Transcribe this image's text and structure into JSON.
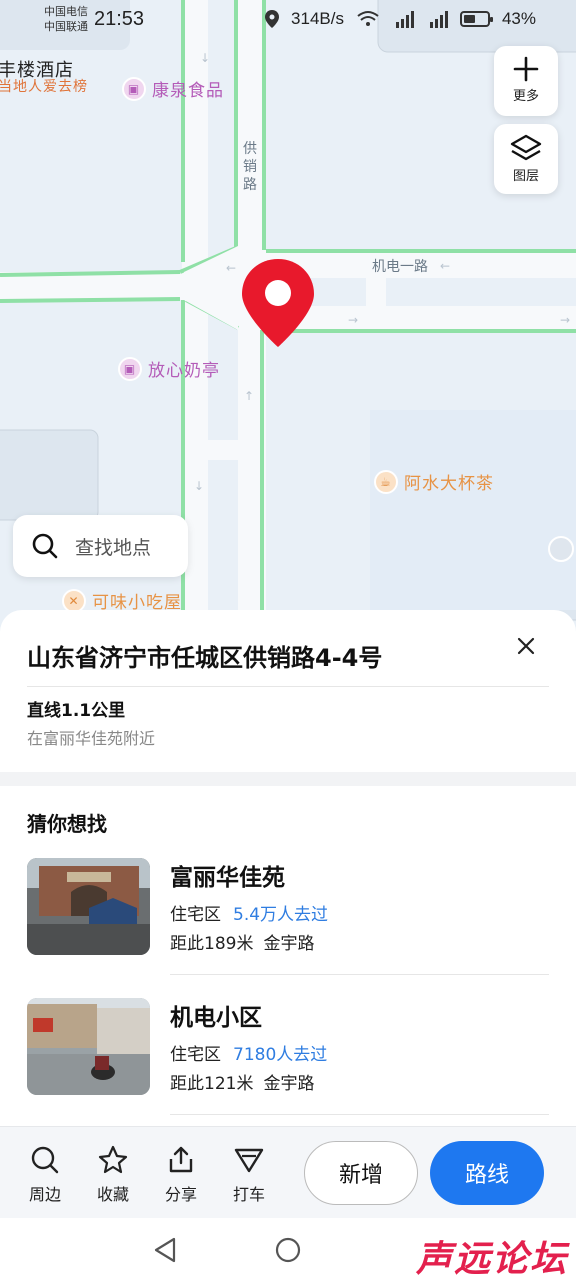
{
  "status_bar": {
    "carrier1": "中国电信",
    "carrier2": "中国联通",
    "time": "21:53",
    "speed": "314B/s",
    "battery": "43%"
  },
  "map": {
    "poi": {
      "hotel": "丰楼酒店",
      "hotel_tag": "当地人爱去榜",
      "kangquan": "康泉食品",
      "milk": "放心奶亭",
      "tea": "阿水大杯茶",
      "snack": "可味小吃屋"
    },
    "roads": {
      "gongxiao": "供销路",
      "jidian": "机电一路"
    },
    "more_label": "更多",
    "layers_label": "图层",
    "search_placeholder": "查找地点"
  },
  "place": {
    "address": "山东省济宁市任城区供销路4-4号",
    "distance": "直线1.1公里",
    "nearby": "在富丽华佳苑附近"
  },
  "recommendations": {
    "title": "猜你想找",
    "items": [
      {
        "name": "富丽华佳苑",
        "type": "住宅区",
        "visits": "5.4万人去过",
        "distance": "距此189米",
        "road": "金宇路"
      },
      {
        "name": "机电小区",
        "type": "住宅区",
        "visits": "7180人去过",
        "distance": "距此121米",
        "road": "金宇路"
      }
    ]
  },
  "actions": {
    "nearby": "周边",
    "favorite": "收藏",
    "share": "分享",
    "taxi": "打车",
    "add": "新增",
    "route": "路线"
  },
  "watermark": "声远论坛",
  "colors": {
    "accent": "#1e78f0",
    "pin": "#e8192c",
    "road_green": "#8fe0a6",
    "poi_purple": "#b45cb8",
    "poi_orange": "#e79345"
  }
}
